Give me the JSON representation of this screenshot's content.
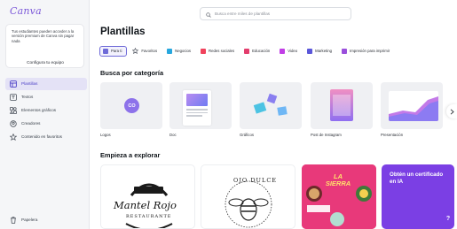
{
  "app": {
    "logo": "Canva",
    "brand_color": "#7d5ad9",
    "accent_color": "#6f6bd8"
  },
  "sidebar": {
    "promo": {
      "text": "Tus estudiantes pueden acceder a la versión premium de Canva sin pagar nada",
      "button_label": "Configura tu equipo"
    },
    "items": [
      {
        "label": "Plantillas",
        "icon": "template-icon",
        "active": true
      },
      {
        "label": "Textos",
        "icon": "text-icon",
        "active": false
      },
      {
        "label": "Elementos gráficos",
        "icon": "elements-icon",
        "active": false
      },
      {
        "label": "Creadores",
        "icon": "creators-icon",
        "active": false
      },
      {
        "label": "Contenido en favoritos",
        "icon": "star-icon",
        "active": false
      }
    ],
    "trash_label": "Papelera"
  },
  "search": {
    "placeholder": "Busca entre miles de plantillas"
  },
  "main": {
    "title": "Plantillas",
    "chips": [
      {
        "label": "Para ti",
        "color": "#6f6bd8",
        "active": true
      },
      {
        "label": "Favoritos",
        "color": "#5a5f69",
        "active": false
      },
      {
        "label": "Negocios",
        "color": "#27a7de",
        "active": false
      },
      {
        "label": "Redes sociales",
        "color": "#f0425c",
        "active": false
      },
      {
        "label": "Educación",
        "color": "#e33d6d",
        "active": false
      },
      {
        "label": "Video",
        "color": "#c13ee6",
        "active": false
      },
      {
        "label": "Marketing",
        "color": "#5b57d9",
        "active": false
      },
      {
        "label": "Impresión para imprimir",
        "color": "#9a4fdc",
        "active": false
      }
    ],
    "categories_heading": "Busca por categoría",
    "categories": [
      {
        "label": "Logos"
      },
      {
        "label": "Doc"
      },
      {
        "label": "Gráficos"
      },
      {
        "label": "Post de Instagram"
      },
      {
        "label": "Presentación"
      }
    ],
    "explore_heading": "Empieza a explorar",
    "explore_cards": [
      {
        "label": "Mantel Rojo",
        "sub": "RESTAURANTE"
      },
      {
        "label": "OJO DULCE"
      },
      {
        "label": "LA SIERRA"
      },
      {
        "label": "Obtén un certificado en IA"
      }
    ]
  }
}
